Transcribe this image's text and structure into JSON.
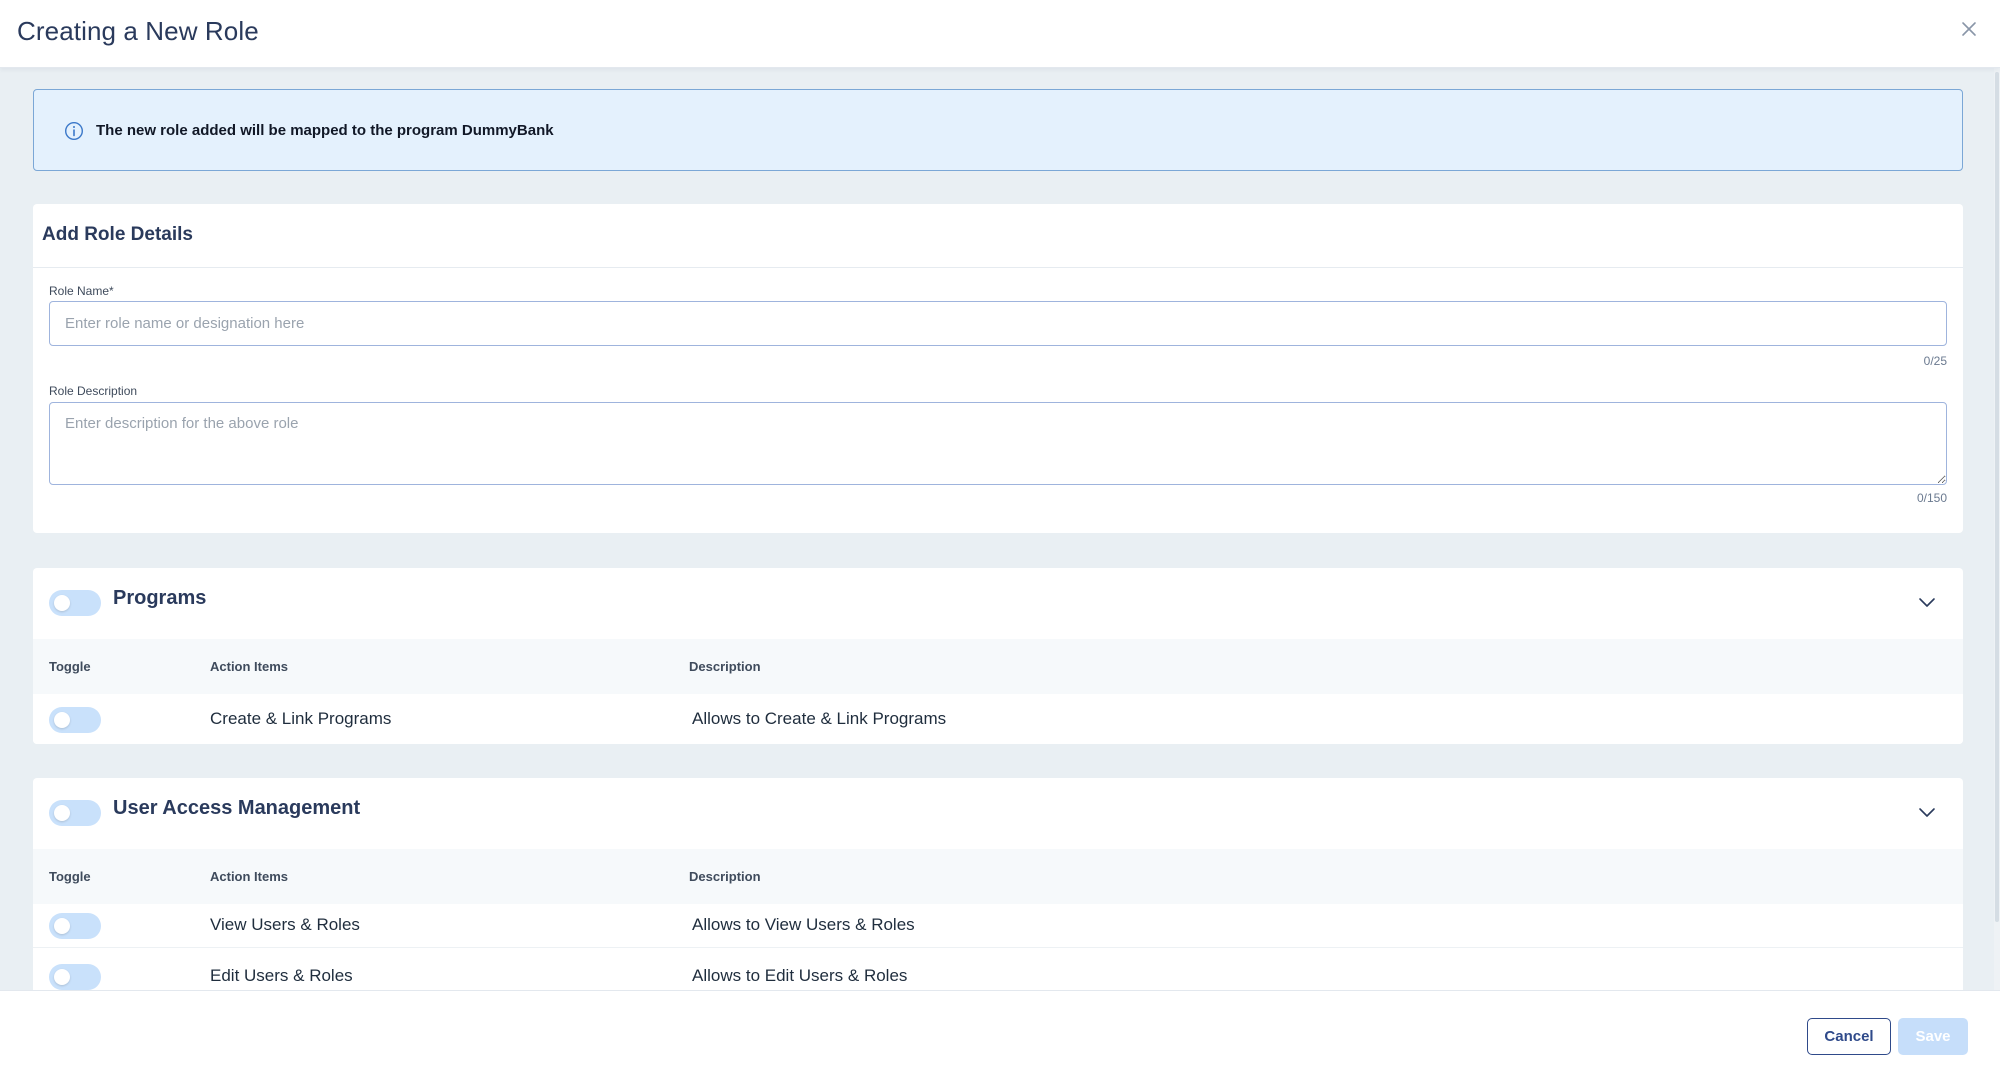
{
  "header": {
    "title": "Creating a New Role",
    "close_icon": "close-icon"
  },
  "info_banner": {
    "icon": "info-icon",
    "text": "The new role added will be mapped to the program DummyBank"
  },
  "role_details": {
    "title": "Add Role Details",
    "role_name": {
      "label": "Role Name*",
      "value": "",
      "placeholder": "Enter role name or designation here",
      "counter": "0/25"
    },
    "role_description": {
      "label": "Role Description",
      "value": "",
      "placeholder": "Enter description for the above role",
      "counter": "0/150"
    }
  },
  "columns": {
    "toggle": "Toggle",
    "action": "Action Items",
    "description": "Description"
  },
  "sections": [
    {
      "title": "Programs",
      "enabled": false,
      "rows": [
        {
          "action": "Create & Link Programs",
          "description": "Allows to Create & Link Programs",
          "enabled": false
        }
      ]
    },
    {
      "title": "User Access Management",
      "enabled": false,
      "rows": [
        {
          "action": "View Users & Roles",
          "description": "Allows to View Users & Roles",
          "enabled": false
        },
        {
          "action": "Edit Users & Roles",
          "description": "Allows to Edit Users & Roles",
          "enabled": false
        }
      ]
    }
  ],
  "footer": {
    "cancel_label": "Cancel",
    "save_label": "Save"
  },
  "colors": {
    "accent": "#2f4a8a",
    "banner_bg": "#e4f1fd",
    "toggle_off": "#c9e1fb",
    "save_disabled": "#c6defa"
  }
}
